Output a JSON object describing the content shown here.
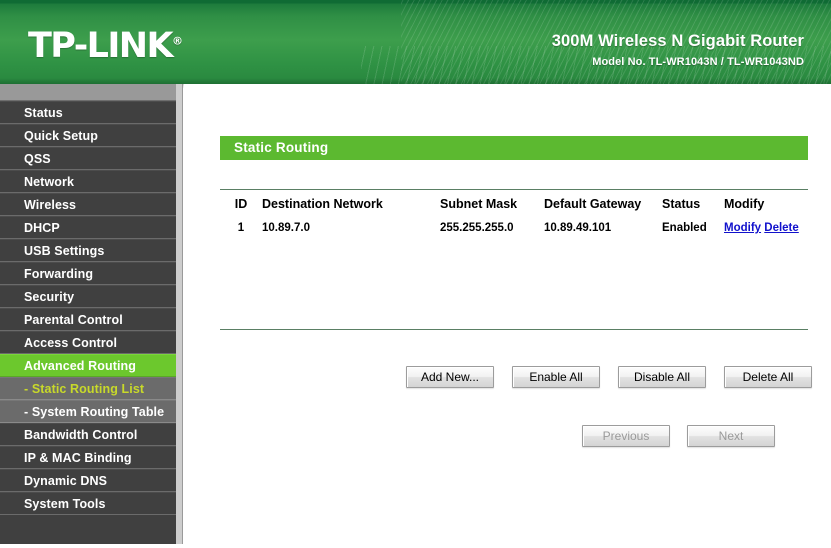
{
  "header": {
    "logo": "TP-LINK",
    "logo_mark": "®",
    "product_title": "300M Wireless N Gigabit Router",
    "model_line": "Model No. TL-WR1043N / TL-WR1043ND"
  },
  "sidebar": {
    "items": [
      {
        "label": "Status",
        "state": "normal"
      },
      {
        "label": "Quick Setup",
        "state": "normal"
      },
      {
        "label": "QSS",
        "state": "normal"
      },
      {
        "label": "Network",
        "state": "normal"
      },
      {
        "label": "Wireless",
        "state": "normal"
      },
      {
        "label": "DHCP",
        "state": "normal"
      },
      {
        "label": "USB Settings",
        "state": "normal"
      },
      {
        "label": "Forwarding",
        "state": "normal"
      },
      {
        "label": "Security",
        "state": "normal"
      },
      {
        "label": "Parental Control",
        "state": "normal"
      },
      {
        "label": "Access Control",
        "state": "normal"
      },
      {
        "label": "Advanced Routing",
        "state": "active"
      },
      {
        "label": "- Static Routing List",
        "state": "sub-active"
      },
      {
        "label": "- System Routing Table",
        "state": "sub"
      },
      {
        "label": "Bandwidth Control",
        "state": "normal"
      },
      {
        "label": "IP & MAC Binding",
        "state": "normal"
      },
      {
        "label": "Dynamic DNS",
        "state": "normal"
      },
      {
        "label": "System Tools",
        "state": "normal"
      }
    ]
  },
  "main": {
    "page_title": "Static Routing",
    "table": {
      "headers": [
        "ID",
        "Destination Network",
        "Subnet Mask",
        "Default Gateway",
        "Status",
        "Modify"
      ],
      "rows": [
        {
          "id": "1",
          "destination_network": "10.89.7.0",
          "subnet_mask": "255.255.255.0",
          "default_gateway": "10.89.49.101",
          "status": "Enabled",
          "modify_link": "Modify",
          "delete_link": "Delete"
        }
      ]
    },
    "actions": [
      {
        "label": "Add New...",
        "disabled": false
      },
      {
        "label": "Enable All",
        "disabled": false
      },
      {
        "label": "Disable All",
        "disabled": false
      },
      {
        "label": "Delete All",
        "disabled": false
      }
    ],
    "pagination": [
      {
        "label": "Previous",
        "disabled": true
      },
      {
        "label": "Next",
        "disabled": true
      }
    ]
  },
  "colors": {
    "brand_green": "#3d9e4c",
    "title_bar_green": "#5cb930",
    "active_menu_green": "#6cc82d",
    "sub_active_text": "#c8d92a",
    "sidebar_dark": "#404040",
    "link_blue": "#1111cc"
  }
}
